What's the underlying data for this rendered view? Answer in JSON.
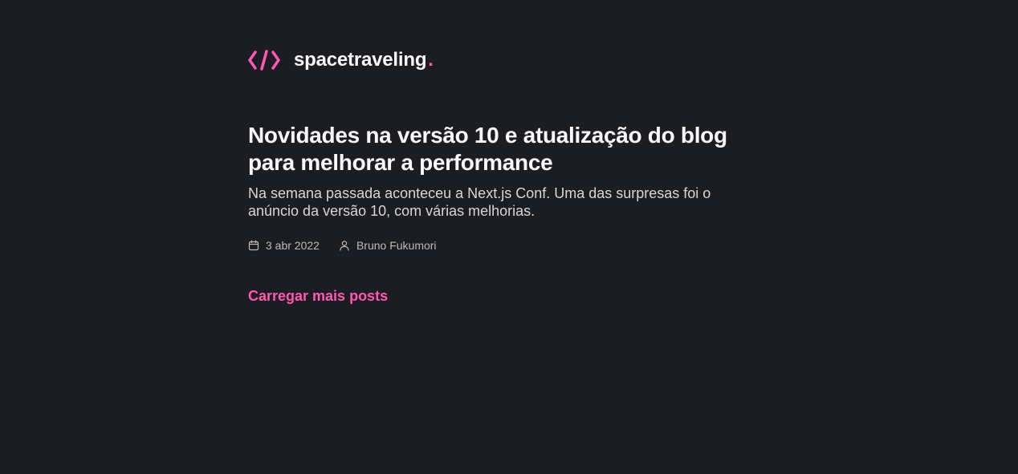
{
  "header": {
    "logo_icon": "code-brackets-icon",
    "logo_text": "spacetraveling",
    "logo_dot": ".",
    "accent_color": "#ff57b2"
  },
  "posts": [
    {
      "title": "Novidades na versão 10 e atualização do blog para melhorar a performance",
      "subtitle": "Na semana passada aconteceu a Next.js Conf. Uma das surpresas foi o anúncio da versão 10, com várias melhorias.",
      "date": "3 abr 2022",
      "date_icon": "calendar-icon",
      "author": "Bruno Fukumori",
      "author_icon": "user-icon"
    }
  ],
  "load_more_label": "Carregar mais posts",
  "colors": {
    "background": "#1b1d23",
    "heading": "#f8f8f8",
    "body_text": "#d7d7d7",
    "info_text": "#bbbbbb"
  }
}
